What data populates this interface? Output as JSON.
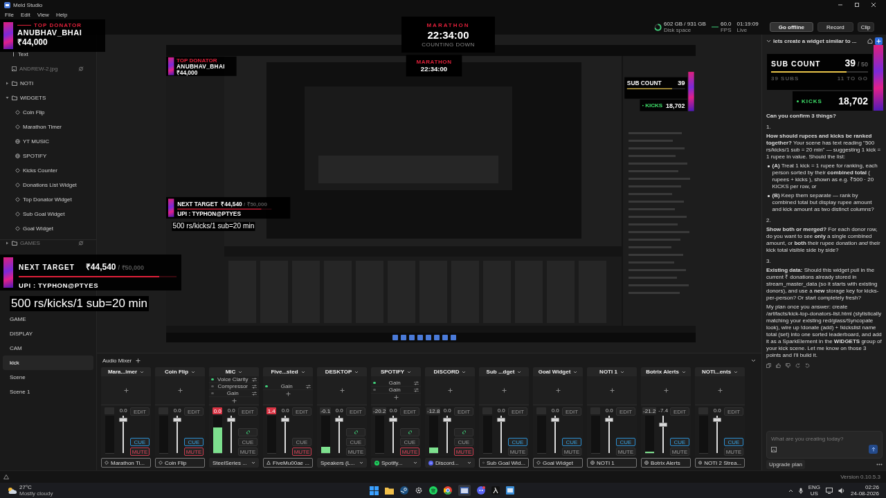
{
  "window": {
    "title": "Meld Studio",
    "menu": [
      "File",
      "Edit",
      "View",
      "Help"
    ]
  },
  "topbar": {
    "stats": [
      {
        "kind": "disk",
        "value": "602 GB / 931 GB",
        "label": "Disk space"
      },
      {
        "kind": "fps",
        "value": "60.0",
        "label": "FPS"
      },
      {
        "kind": "live",
        "value": "01:19:09",
        "label": "Live"
      }
    ],
    "buttons": [
      {
        "label": "Go offline",
        "kind": "primary"
      },
      {
        "label": "Record",
        "kind": "normal"
      },
      {
        "label": "Clip",
        "kind": "normal"
      }
    ]
  },
  "sidebar": {
    "layers": [
      {
        "label": "Text",
        "kind": "text",
        "hidden": false
      },
      {
        "label": "ANDREW-2.jpg",
        "kind": "image",
        "hidden": true
      },
      {
        "label": "NOTI",
        "kind": "folder",
        "expanded": false,
        "hidden": false
      },
      {
        "label": "WIDGETS",
        "kind": "folder",
        "expanded": true,
        "hidden": false,
        "children": [
          {
            "label": "Coin Flip",
            "kind": "widget",
            "hidden": false
          },
          {
            "label": "Marathon Timer",
            "kind": "widget",
            "hidden": false
          },
          {
            "label": "YT MUSIC",
            "kind": "browser",
            "hidden": false
          },
          {
            "label": "SPOTIFY",
            "kind": "browser",
            "hidden": false
          },
          {
            "label": "Kicks Counter",
            "kind": "widget",
            "hidden": false
          },
          {
            "label": "Donations List Widget",
            "kind": "widget",
            "hidden": false
          },
          {
            "label": "Top Donator Widget",
            "kind": "widget",
            "hidden": false
          },
          {
            "label": "Sub Goal Widget",
            "kind": "widget",
            "hidden": false
          },
          {
            "label": "Goal Widget",
            "kind": "widget",
            "hidden": false
          }
        ]
      },
      {
        "label": "GAMES",
        "kind": "folder",
        "expanded": false,
        "hidden": true
      }
    ],
    "scenes": [
      {
        "label": "GAME",
        "selected": false
      },
      {
        "label": "DISPLAY",
        "selected": false
      },
      {
        "label": "CAM",
        "selected": false
      },
      {
        "label": "kick",
        "selected": true
      },
      {
        "label": "Scene",
        "selected": false
      },
      {
        "label": "Scene 1",
        "selected": false
      }
    ]
  },
  "mixer": {
    "title": "Audio Mixer",
    "channels": [
      {
        "name": "Mara...imer",
        "clipping": false,
        "fader": {
          "reading": "0.0",
          "level": 0.93
        },
        "edit": "EDIT",
        "cue": {
          "label": "CUE",
          "on": true
        },
        "mute": {
          "label": "MUTE",
          "on": true
        },
        "source": {
          "label": "Marathon Ti...",
          "kind": "widget"
        }
      },
      {
        "name": "Coin Flip",
        "clipping": false,
        "fader": {
          "reading": "0.0",
          "level": 0.93
        },
        "edit": "EDIT",
        "cue": {
          "label": "CUE",
          "on": true
        },
        "mute": {
          "label": "MUTE",
          "on": true
        },
        "source": {
          "label": "Coin Flip",
          "kind": "widget"
        }
      },
      {
        "name": "MIC",
        "effects": [
          {
            "label": "Voice Clarity",
            "on": true
          },
          {
            "label": "Compressor",
            "on": false
          },
          {
            "label": "Gain",
            "on": false
          }
        ],
        "peak": "0.0",
        "clipping": true,
        "meter": {
          "level": 0.68
        },
        "fader": {
          "reading": "0.0",
          "level": 0.93
        },
        "linked": true,
        "edit": "EDIT",
        "cue": {
          "label": "CUE",
          "on": false
        },
        "mute": {
          "label": "MUTE",
          "on": false
        },
        "source": {
          "label": "SteelSeries ...",
          "kind": "device"
        }
      },
      {
        "name": "Five...sted",
        "effects": [
          {
            "label": "Gain",
            "on": true
          }
        ],
        "peak": "1.4",
        "clipping": true,
        "fader": {
          "reading": "0.0",
          "level": 0.93
        },
        "edit": "EDIT",
        "cue": {
          "label": "CUE",
          "on": false
        },
        "mute": {
          "label": "MUTE",
          "on": true
        },
        "source": {
          "label": "FiveMu00ae ...",
          "kind": "app"
        }
      },
      {
        "name": "DESKTOP",
        "peak": "-0.1",
        "clipping": false,
        "meter": {
          "level": 0.16
        },
        "fader": {
          "reading": "0.0",
          "level": 0.93
        },
        "linked": true,
        "edit": "EDIT",
        "cue": {
          "label": "CUE",
          "on": false
        },
        "mute": {
          "label": "MUTE",
          "on": false
        },
        "source": {
          "label": "Speakers (L...",
          "kind": "device"
        }
      },
      {
        "name": "SPOTIFY",
        "effects": [
          {
            "label": "Gain",
            "on": true
          },
          {
            "label": "Gain",
            "on": false
          }
        ],
        "peak": "-20.2",
        "clipping": false,
        "fader": {
          "reading": "0.0",
          "level": 0.93
        },
        "linked": true,
        "edit": "EDIT",
        "cue": {
          "label": "CUE",
          "on": false
        },
        "mute": {
          "label": "MUTE",
          "on": true
        },
        "source": {
          "label": "Spotify...",
          "kind": "spotify"
        }
      },
      {
        "name": "DISCORD",
        "peak": "-12.8",
        "clipping": false,
        "meter": {
          "level": 0.15
        },
        "fader": {
          "reading": "0.0",
          "level": 0.93
        },
        "linked": true,
        "edit": "EDIT",
        "cue": {
          "label": "CUE",
          "on": false
        },
        "mute": {
          "label": "MUTE",
          "on": true
        },
        "source": {
          "label": "Discord...",
          "kind": "discord"
        }
      },
      {
        "name": "Sub ...dget",
        "clipping": false,
        "fader": {
          "reading": "0.0",
          "level": 0.93
        },
        "edit": "EDIT",
        "cue": {
          "label": "CUE",
          "on": true
        },
        "mute": {
          "label": "MUTE",
          "on": false
        },
        "source": {
          "label": "Sub Goal Wid...",
          "kind": "widget"
        }
      },
      {
        "name": "Goal Widget",
        "clipping": false,
        "fader": {
          "reading": "0.0",
          "level": 0.93
        },
        "edit": "EDIT",
        "cue": {
          "label": "CUE",
          "on": true
        },
        "mute": {
          "label": "MUTE",
          "on": false
        },
        "source": {
          "label": "Goal Widget",
          "kind": "widget"
        }
      },
      {
        "name": "NOTI 1",
        "clipping": false,
        "fader": {
          "reading": "0.0",
          "level": 0.93
        },
        "edit": "EDIT",
        "cue": {
          "label": "CUE",
          "on": true
        },
        "mute": {
          "label": "MUTE",
          "on": false
        },
        "source": {
          "label": "NOTI 1",
          "kind": "browser"
        }
      },
      {
        "name": "Botrix Alerts",
        "peak": "-21.2",
        "clipping": false,
        "meter": {
          "level": 0.03
        },
        "fader": {
          "reading": "-7.4",
          "level": 0.8
        },
        "edit": "EDIT",
        "cue": {
          "label": "CUE",
          "on": true
        },
        "mute": {
          "label": "MUTE",
          "on": false
        },
        "source": {
          "label": "Botrix Alerts",
          "kind": "browser"
        }
      },
      {
        "name": "NOTI...ents",
        "clipping": false,
        "fader": {
          "reading": "0.0",
          "level": 0.93
        },
        "edit": "EDIT",
        "cue": {
          "label": "CUE",
          "on": true
        },
        "mute": {
          "label": "MUTE",
          "on": false
        },
        "source": {
          "label": "NOTI 2 Strea...",
          "kind": "browser"
        }
      }
    ]
  },
  "chat": {
    "title": "lets create a widget similar to ...",
    "messages": [
      {
        "kind": "text",
        "text": "**Can you confirm 3 things?**"
      },
      {
        "kind": "number",
        "text": "1."
      },
      {
        "kind": "text",
        "text": "**How should rupees and kicks be ranked together?** Your scene has text reading \"500 rs/kicks/1 sub = 20 min\" — suggesting 1 kick = 1 rupee in value. Should the list:"
      },
      {
        "kind": "bullet",
        "text": "**(A)** Treat 1 kick = 1 rupee for ranking, each person sorted by their **combined total** ( rupees + kicks ), shown as e.g. ₹500 · 20 KICKS per row, or"
      },
      {
        "kind": "bullet",
        "text": "**(B)** Keep them separate — rank by combined total but display rupee amount and kick amount as two distinct columns?"
      },
      {
        "kind": "number",
        "text": "2."
      },
      {
        "kind": "text",
        "text": "**Show both or merged?** For each donor row, do you want to see **only** a single combined amount, or **both** their rupee donation *and* their kick total visible side by side?"
      },
      {
        "kind": "number",
        "text": "3."
      },
      {
        "kind": "text",
        "text": "**Existing data:** Should this widget pull in the current ₹ donations already stored in stream_master_data (so it starts with existing donors), and use a **new** storage key for kicks-per-person? Or start completely fresh?"
      },
      {
        "kind": "text",
        "text": "My plan once you answer: create /artifacts/kick-top-donators-list.html (stylistically matching your existing red/glass/Syncopate look), wire up !donate (add) + !kickslist name total (set) into one sorted leaderboard, and add it as a SparkElement in the **WIDGETS** group of your kick scene. Let me know on those 3 points and I'll build it."
      }
    ],
    "placeholder": "What are you creating today?",
    "upgrade": "Upgrade plan"
  },
  "overlays": {
    "top_donator": {
      "label": "TOP DONATOR",
      "name": "ANUBHAV_BHAI",
      "amount": "₹44,000"
    },
    "marathon": {
      "label": "MARATHON",
      "time": "22:34:00",
      "status": "COUNTING DOWN"
    },
    "next_target": {
      "label": "NEXT TARGET",
      "amount": "₹44,540",
      "goal": "/ ₹50,000",
      "level": 0.89,
      "upi": "UPI : TYPHON@PTYES"
    },
    "caption": "500 rs/kicks/1 sub=20 min",
    "sub_count": {
      "label": "SUB COUNT",
      "count": "39",
      "goal": "/ 50",
      "level": 0.78,
      "subs": "39 SUBS",
      "to_go": "11 TO GO"
    },
    "kicks": {
      "label": "KICKS",
      "count": "18,702"
    }
  },
  "preview": {
    "overlays": {
      "top_donator": {
        "label": "TOP DONATOR",
        "name": "ANUBHAV_BHAI",
        "amount": "₹44,000"
      },
      "marathon": {
        "label": "MARATHON",
        "time": "22:34:00"
      },
      "next_target": {
        "label": "NEXT TARGET",
        "amount": "₹44,540",
        "goal": "/ ₹50,000",
        "level": 0.89,
        "upi": "UPI : TYPHON@PTYES"
      },
      "caption": "500 rs/kicks/1 sub=20 min",
      "sub_count": {
        "label": "SUB COUNT",
        "count": "39",
        "level": 0.78
      },
      "kicks": {
        "label": "KICKS",
        "count": "18,702"
      }
    }
  },
  "status_bar": {
    "version": "Version 0.10.5.3"
  },
  "taskbar": {
    "weather": {
      "temp": "27°C",
      "desc": "Mostly cloudy"
    },
    "language": [
      "ENG",
      "US"
    ],
    "time": "02:26",
    "date": "24-08-2026"
  }
}
